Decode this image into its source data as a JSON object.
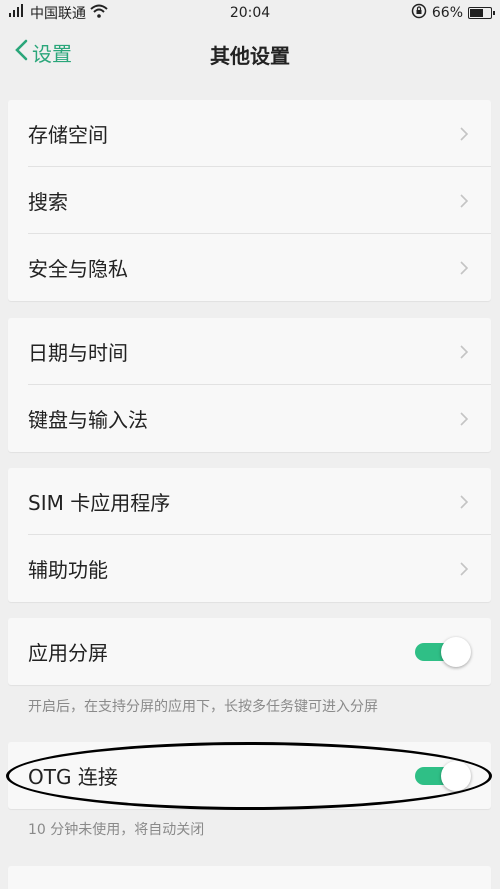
{
  "status_bar": {
    "carrier": "中国联通",
    "time": "20:04",
    "battery_percent": "66%",
    "battery_level": 0.66
  },
  "nav": {
    "back_label": "设置",
    "title": "其他设置"
  },
  "groups": [
    {
      "items": [
        {
          "label": "存储空间"
        },
        {
          "label": "搜索"
        },
        {
          "label": "安全与隐私"
        }
      ]
    },
    {
      "items": [
        {
          "label": "日期与时间"
        },
        {
          "label": "键盘与输入法"
        }
      ]
    },
    {
      "items": [
        {
          "label": "SIM 卡应用程序"
        },
        {
          "label": "辅助功能"
        }
      ]
    }
  ],
  "split_screen": {
    "label": "应用分屏",
    "enabled": true,
    "hint": "开启后，在支持分屏的应用下，长按多任务键可进入分屏"
  },
  "otg": {
    "label": "OTG 连接",
    "enabled": true,
    "hint": "10 分钟未使用，将自动关闭"
  },
  "colors": {
    "accent": "#2aa67a",
    "toggle_on": "#2fbf86"
  }
}
